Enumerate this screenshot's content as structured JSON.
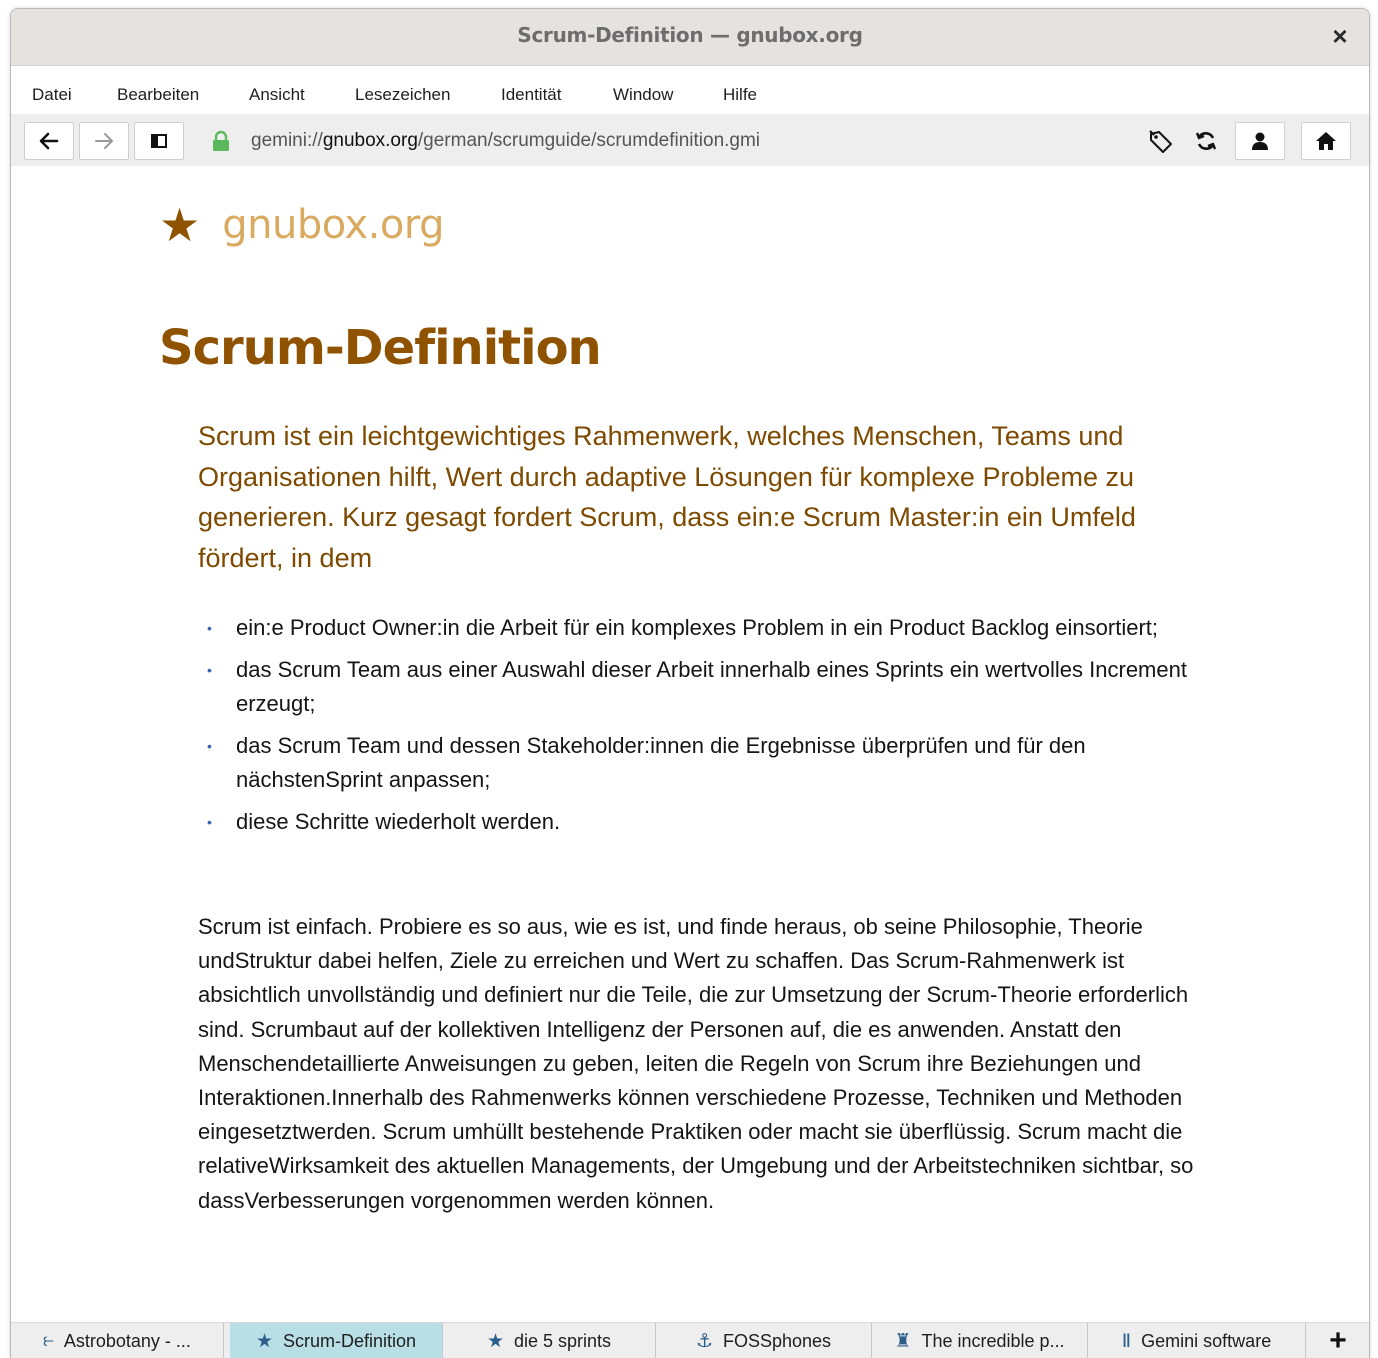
{
  "window": {
    "title": "Scrum-Definition — gnubox.org",
    "close_label": "×"
  },
  "menu": {
    "items": [
      "Datei",
      "Bearbeiten",
      "Ansicht",
      "Lesezeichen",
      "Identität",
      "Window",
      "Hilfe"
    ]
  },
  "toolbar": {
    "url_scheme": "gemini://",
    "url_host": "gnubox.org",
    "url_path": "/german/scrumguide/scrumdefinition.gmi",
    "icons": [
      "back-arrow-icon",
      "forward-arrow-icon",
      "sidebar-icon",
      "lock-icon",
      "bookmark-tag-icon",
      "reload-icon",
      "identity-icon",
      "home-icon"
    ]
  },
  "page": {
    "site_star": "★",
    "site_name": "gnubox.org",
    "heading": "Scrum-Definition",
    "lead": "Scrum ist ein leichtgewichtiges Rahmenwerk, welches Menschen, Teams und Organisationen hilft, Wert durch adaptive Lösungen für komplexe Probleme zu generieren. Kurz gesagt fordert Scrum, dass ein:e Scrum Master:in ein Umfeld fördert, in dem",
    "bullet_marker": "•",
    "bullets": [
      "ein:e Product Owner:in die Arbeit für ein komplexes Problem in ein Product Backlog einsortiert;",
      "das Scrum Team aus einer Auswahl dieser Arbeit innerhalb eines Sprints ein wertvolles Increment erzeugt;",
      "das Scrum Team und dessen Stakeholder:innen die Ergebnisse überprüfen und für den nächstenSprint anpassen;",
      "diese Schritte wiederholt werden."
    ],
    "paragraph": "Scrum ist einfach. Probiere es so aus, wie es ist, und finde heraus, ob seine Philosophie, Theorie undStruktur dabei helfen, Ziele zu erreichen und Wert zu schaffen. Das Scrum-Rahmenwerk ist absichtlich unvollständig und definiert nur die Teile, die zur Umsetzung der Scrum-Theorie erforderlich sind. Scrumbaut auf der kollektiven Intelligenz der Personen auf, die es anwenden. Anstatt den Menschendetaillierte Anweisungen zu geben, leiten die Regeln von Scrum ihre Beziehungen und Interaktionen.Innerhalb des Rahmenwerks können verschiedene Prozesse, Techniken und Methoden eingesetztwerden. Scrum umhüllt bestehende Praktiken oder macht sie überflüssig. Scrum macht die relativeWirksamkeit des aktuellen Managements, der Umgebung und der Arbeitstechniken sichtbar, so dassVerbesserungen vorgenommen werden können."
  },
  "tabs": [
    {
      "icon": "⥼",
      "icon_name": "sprout-icon",
      "label": "Astrobotany - ..."
    },
    {
      "icon": "★",
      "icon_name": "star-icon",
      "label": "Scrum-Definition",
      "active": true
    },
    {
      "icon": "★",
      "icon_name": "star-icon",
      "label": "die 5 sprints"
    },
    {
      "icon": "⚓",
      "icon_name": "anchor-icon",
      "label": "FOSSphones"
    },
    {
      "icon": "♜",
      "icon_name": "tower-icon",
      "label": "The incredible p..."
    },
    {
      "icon": "Ⅱ",
      "icon_name": "gemini-icon",
      "label": "Gemini software"
    }
  ],
  "new_tab_label": "+",
  "colors": {
    "accent_brown": "#8f5300",
    "site_name": "#d9aa5f",
    "lead_text": "#7d4a00",
    "active_tab": "#b9dfe6",
    "lock_green": "#5cb85c"
  }
}
